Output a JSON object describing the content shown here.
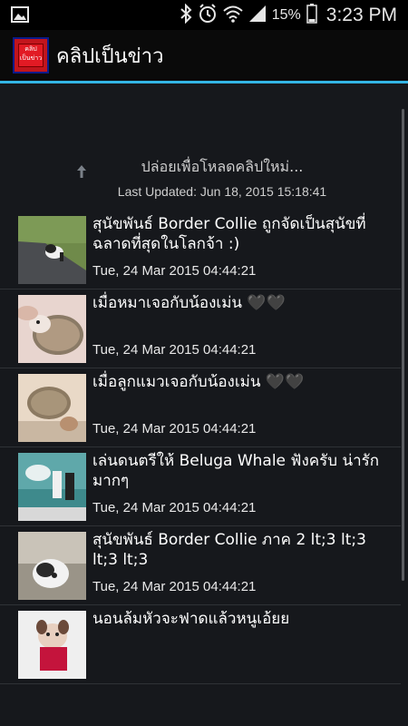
{
  "status_bar": {
    "battery_percent": "15%",
    "time": "3:23 PM",
    "icons": [
      "gallery-icon",
      "bluetooth-icon",
      "alarm-icon",
      "wifi-icon",
      "signal-icon",
      "battery-icon"
    ]
  },
  "action_bar": {
    "title": "คลิปเป็นข่าว",
    "accent_color": "#33b5e5"
  },
  "refresh": {
    "label": "ปล่อยเพื่อโหลดคลิปใหม่...",
    "last_updated": "Last Updated: Jun 18, 2015 15:18:41"
  },
  "items": [
    {
      "title": "สุนัขพันธ์ Border Collie ถูกจัดเป็นสุนัขที่ฉลาดที่สุดในโลกจ้า :)",
      "date": "Tue, 24 Mar 2015 04:44:21"
    },
    {
      "title": "เมื่อหมาเจอกับน้องเม่น 🖤🖤",
      "date": "Tue, 24 Mar 2015 04:44:21"
    },
    {
      "title": "เมื่อลูกแมวเจอกับน้องเม่น 🖤🖤",
      "date": "Tue, 24 Mar 2015 04:44:21"
    },
    {
      "title": "เล่นดนตรีให้ Beluga Whale ฟังครับ น่ารักมากๆ",
      "date": "Tue, 24 Mar 2015 04:44:21"
    },
    {
      "title": "สุนัขพันธ์ Border Collie ภาค 2  lt;3 lt;3 lt;3 lt;3",
      "date": "Tue, 24 Mar 2015 04:44:21"
    },
    {
      "title": "นอนล้มหัวจะฟาดแล้วหนูเอ้ยย",
      "date": ""
    }
  ]
}
